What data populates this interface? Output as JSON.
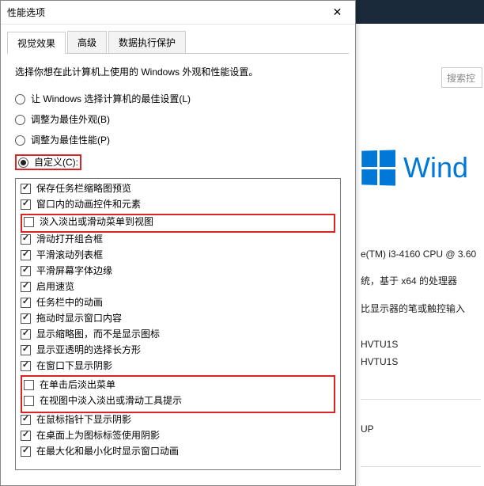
{
  "dialog": {
    "title": "性能选项",
    "close": "✕",
    "tabs": [
      "视觉效果",
      "高级",
      "数据执行保护"
    ],
    "desc": "选择你想在此计算机上使用的 Windows 外观和性能设置。",
    "radios": [
      {
        "label": "让 Windows 选择计算机的最佳设置(L)",
        "checked": false
      },
      {
        "label": "调整为最佳外观(B)",
        "checked": false
      },
      {
        "label": "调整为最佳性能(P)",
        "checked": false
      },
      {
        "label": "自定义(C):",
        "checked": true
      }
    ],
    "items": [
      {
        "label": "保存任务栏缩略图预览",
        "checked": true
      },
      {
        "label": "窗口内的动画控件和元素",
        "checked": true
      },
      {
        "label": "淡入淡出或滑动菜单到视图",
        "checked": false,
        "highlight": true
      },
      {
        "label": "滑动打开组合框",
        "checked": true
      },
      {
        "label": "平滑滚动列表框",
        "checked": true
      },
      {
        "label": "平滑屏幕字体边缘",
        "checked": true
      },
      {
        "label": "启用速览",
        "checked": true
      },
      {
        "label": "任务栏中的动画",
        "checked": true
      },
      {
        "label": "拖动时显示窗口内容",
        "checked": true
      },
      {
        "label": "显示缩略图，而不是显示图标",
        "checked": true
      },
      {
        "label": "显示亚透明的选择长方形",
        "checked": true
      },
      {
        "label": "在窗口下显示阴影",
        "checked": true
      },
      {
        "label": "在单击后淡出菜单",
        "checked": false,
        "highlight": true,
        "group": "a"
      },
      {
        "label": "在视图中淡入淡出或滑动工具提示",
        "checked": false,
        "highlight": true,
        "group": "a"
      },
      {
        "label": "在鼠标指针下显示阴影",
        "checked": true
      },
      {
        "label": "在桌面上为图标标签使用阴影",
        "checked": true
      },
      {
        "label": "在最大化和最小化时显示窗口动画",
        "checked": true
      }
    ]
  },
  "right": {
    "search_placeholder": "搜索控",
    "brand": "Wind",
    "lines": [
      "e(TM) i3-4160 CPU @ 3.60",
      "统，基于 x64 的处理器",
      "比显示器的笔或触控输入"
    ],
    "block": [
      "HVTU1S",
      "HVTU1S"
    ],
    "block2": "UP"
  }
}
